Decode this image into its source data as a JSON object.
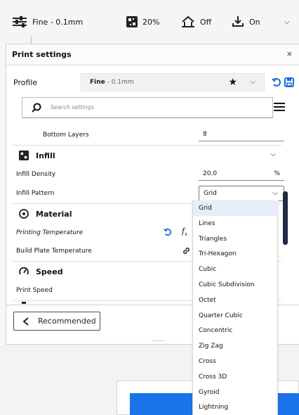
{
  "topbar": {
    "profile": "Fine - 0.1mm",
    "infill": "20%",
    "support": "Off",
    "adhesion": "On"
  },
  "panel": {
    "title": "Print settings",
    "close": "×",
    "profile_label": "Profile",
    "profile_name": "Fine",
    "profile_sub": " - 0.1mm",
    "star": "★",
    "search_placeholder": "Search settings"
  },
  "settings": {
    "bottom_layers": {
      "label": "Bottom Layers",
      "value": "8"
    },
    "infill_category": "Infill",
    "infill_density": {
      "label": "Infill Density",
      "value": "20.0",
      "unit": "%"
    },
    "infill_pattern": {
      "label": "Infill Pattern",
      "value": "Grid"
    },
    "material_category": "Material",
    "printing_temperature": {
      "label": "Printing Temperature"
    },
    "build_plate_temperature": {
      "label": "Build Plate Temperature"
    },
    "speed_category": "Speed",
    "print_speed": {
      "label": "Print Speed"
    }
  },
  "dropdown_options": [
    "Grid",
    "Lines",
    "Triangles",
    "Tri-Hexagon",
    "Cubic",
    "Cubic Subdivision",
    "Octet",
    "Quarter Cubic",
    "Concentric",
    "Zig Zag",
    "Cross",
    "Cross 3D",
    "Gyroid",
    "Lightning"
  ],
  "selected_option_index": 0,
  "buttons": {
    "recommended": "Recommended"
  },
  "colors": {
    "accent": "#1a73e8",
    "selected_option_bg": "#e6eefc",
    "scrollbar": "#1f2a44"
  }
}
